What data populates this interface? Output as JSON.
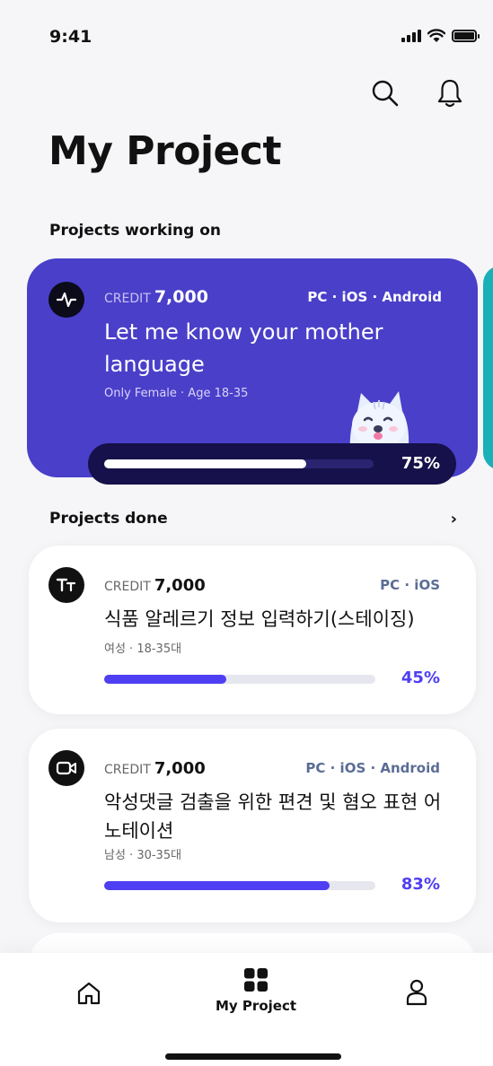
{
  "status_bar": {
    "time": "9:41"
  },
  "header": {
    "title": "My Project",
    "search_icon": "search-icon",
    "bell_icon": "bell-icon"
  },
  "sections": {
    "working_on": "Projects working on",
    "done": "Projects done",
    "done_more": "›"
  },
  "featured": {
    "icon": "activity-icon",
    "credit_label": "CREDIT",
    "credit_value": "7,000",
    "platforms": "PC · iOS · Android",
    "title": "Let me know your mother language",
    "subtitle": "Only Female · Age 18-35",
    "progress_label": "75%",
    "progress": 0.75,
    "color": "#4a3fc9"
  },
  "done_projects": [
    {
      "icon": "text-size-icon",
      "credit_label": "CREDIT",
      "credit_value": "7,000",
      "platforms": "PC · iOS",
      "title": "식품 알레르기 정보 입력하기(스테이징)",
      "subtitle": "여성 · 18-35대",
      "progress_label": "45%",
      "progress": 0.45
    },
    {
      "icon": "video-camera-icon",
      "credit_label": "CREDIT",
      "credit_value": "7,000",
      "platforms": "PC · iOS · Android",
      "title": "악성댓글 검출을 위한 편견 및 혐오 표현 어노테이션",
      "subtitle": "남성 · 30-35대",
      "progress_label": "83%",
      "progress": 0.83
    }
  ],
  "tabbar": {
    "home_icon": "home-icon",
    "project_icon": "grid-icon",
    "project_label": "My Project",
    "profile_icon": "user-icon"
  },
  "colors": {
    "accent": "#4e3ff2",
    "featured_bg": "#4a3fc9",
    "peek_card": "#1ab0b8"
  }
}
